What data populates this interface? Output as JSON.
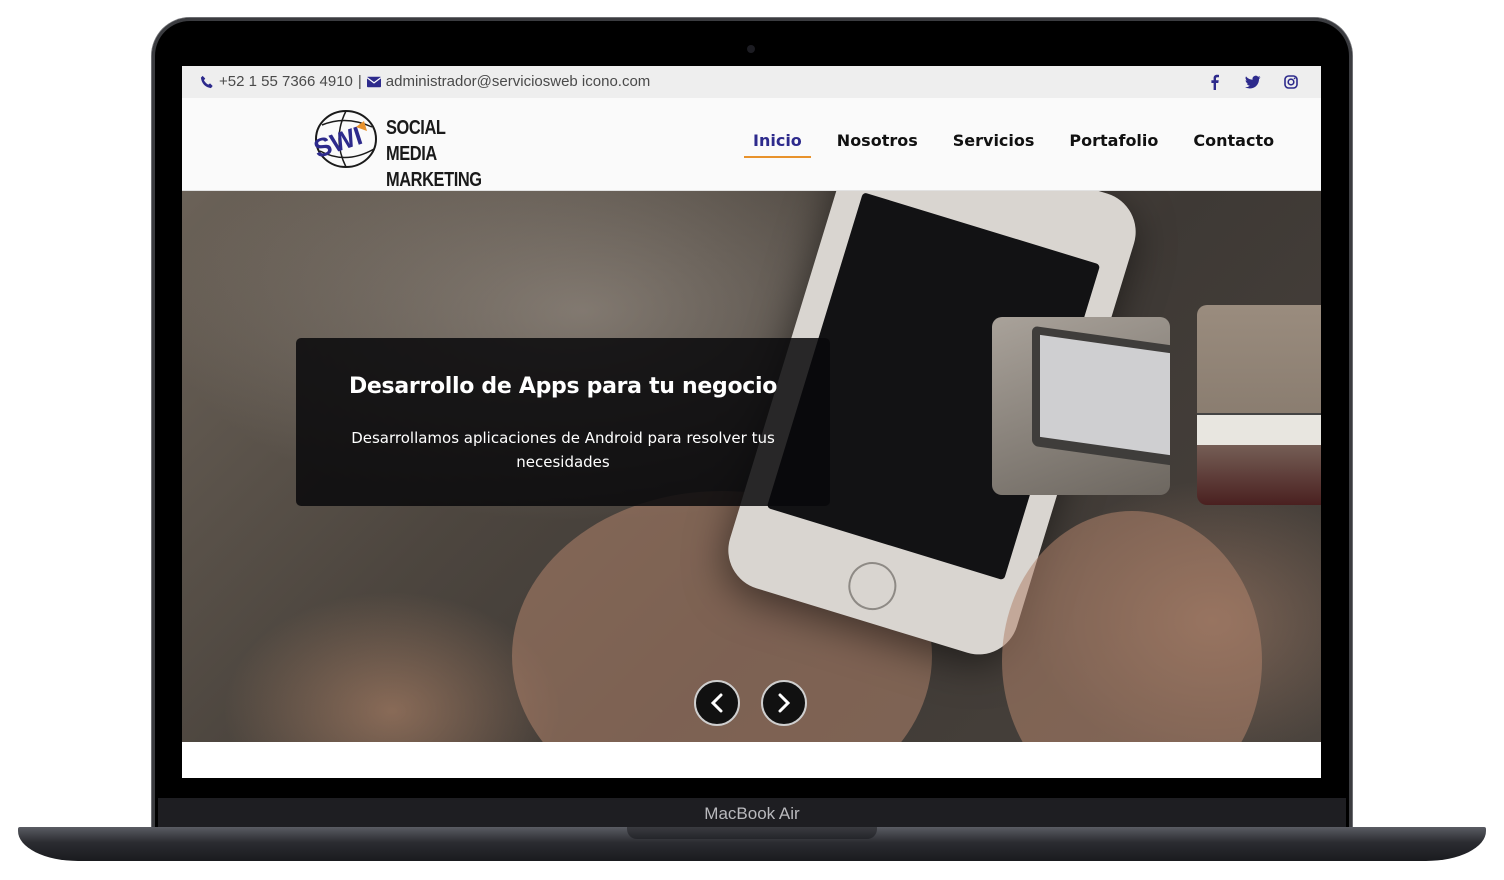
{
  "device": {
    "label": "MacBook Air"
  },
  "topbar": {
    "phone": "+52 1 55 7366 4910",
    "separator": "|",
    "email": "administrador@serviciosweb icono.com",
    "social": [
      "facebook-icon",
      "twitter-icon",
      "instagram-icon"
    ],
    "icon_color": "#2d2a8c"
  },
  "logo": {
    "line1": "SOCIAL MEDIA",
    "line2": "MARKETING",
    "mark": "SWI"
  },
  "nav": {
    "items": [
      {
        "label": "Inicio",
        "active": true
      },
      {
        "label": "Nosotros",
        "active": false
      },
      {
        "label": "Servicios",
        "active": false
      },
      {
        "label": "Portafolio",
        "active": false
      },
      {
        "label": "Contacto",
        "active": false
      }
    ],
    "active_color": "#2d2a8c",
    "underline_color": "#e8922c"
  },
  "hero": {
    "title": "Desarrollo de Apps para tu negocio",
    "text": "Desarrollamos aplicaciones de Android para resolver tus necesidades"
  }
}
